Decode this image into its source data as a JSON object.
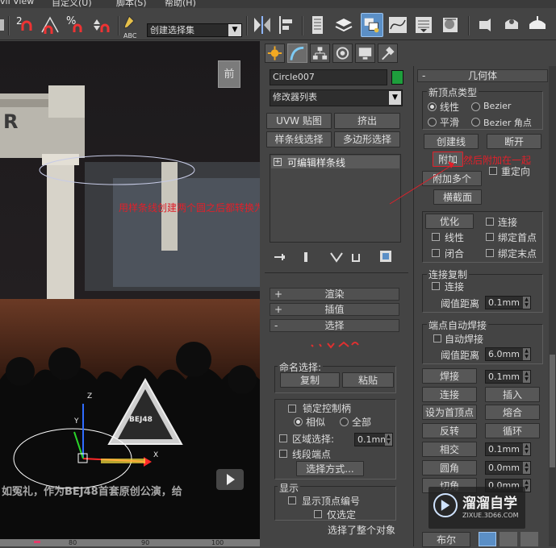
{
  "menubar": {
    "items": [
      "vil View",
      "自定义(U)",
      "脚本(S)",
      "帮助(H)"
    ]
  },
  "toolbar": {
    "selection_set": "创建选择集",
    "abc_label": "ABC",
    "snap_labels": [
      "2",
      "%",
      "n"
    ]
  },
  "viewport": {
    "nav_cube": "前",
    "annotation": "用样条线创建两个圆之后都转换为可编辑样条线",
    "subtitle": "如冤礼，作为BEJ48首套原创公演，给",
    "ruler": [
      "80",
      "90",
      "100"
    ],
    "logo_text": "BEJ48",
    "axis_x": "X",
    "axis_y": "Y",
    "axis_z": "Z"
  },
  "command_panel": {
    "object_name": "Circle007",
    "object_color": "#1e9e3c",
    "modifier_list": "修改器列表",
    "buttons": [
      "UVW 贴图",
      "挤出",
      "样条线选择",
      "多边形选择"
    ],
    "stack_item": "可编辑样条线",
    "rollouts": {
      "render": "渲染",
      "interp": "插值",
      "selection": "选择"
    },
    "named_sel_title": "命名选择:",
    "copy": "复制",
    "paste": "粘贴",
    "lock_handles": "锁定控制柄",
    "similar": "相似",
    "all": "全部",
    "area_sel": "区域选择:",
    "area_value": "0.1mm",
    "segment_end": "线段端点",
    "select_by": "选择方式...",
    "display_title": "显示",
    "show_vertex_num": "显示顶点编号",
    "only_selected": "仅选定",
    "status": "选择了整个对象"
  },
  "geometry_panel": {
    "title": "几何体",
    "new_vertex_type": "新顶点类型",
    "linear": "线性",
    "bezier": "Bezier",
    "smooth": "平滑",
    "bezier_corner": "Bezier 角点",
    "create_line": "创建线",
    "break": "断开",
    "attach": "附加",
    "attach_note": "然后附加在一起",
    "reorient": "重定向",
    "attach_multi": "附加多个",
    "cross_section": "横截面",
    "optimize": "优化",
    "connect": "连接",
    "linear2": "线性",
    "bind_first": "绑定首点",
    "closed": "闭合",
    "bind_last": "绑定末点",
    "connect_copy": "连接复制",
    "connect2": "连接",
    "threshold": "阈值距离",
    "threshold_val1": "0.1mm",
    "end_auto_weld": "端点自动焊接",
    "auto_weld": "自动焊接",
    "threshold2": "阈值距离",
    "threshold_val2": "6.0mm",
    "weld": "焊接",
    "weld_val": "0.1mm",
    "connect3": "连接",
    "insert": "插入",
    "make_first": "设为首顶点",
    "fuse": "熔合",
    "reverse": "反转",
    "cycle": "循环",
    "intersect": "相交",
    "intersect_val": "0.1mm",
    "fillet": "圆角",
    "fillet_val": "0.0mm",
    "chamfer": "切角",
    "chamfer_val": "0.0mm",
    "boolean": "布尔"
  },
  "watermark": {
    "name": "溜溜自学",
    "url": "ZIXUE.3D66.COM"
  },
  "colors": {
    "accent": "#5b8fc6",
    "annotation": "#e0202a",
    "panel": "#444444"
  }
}
